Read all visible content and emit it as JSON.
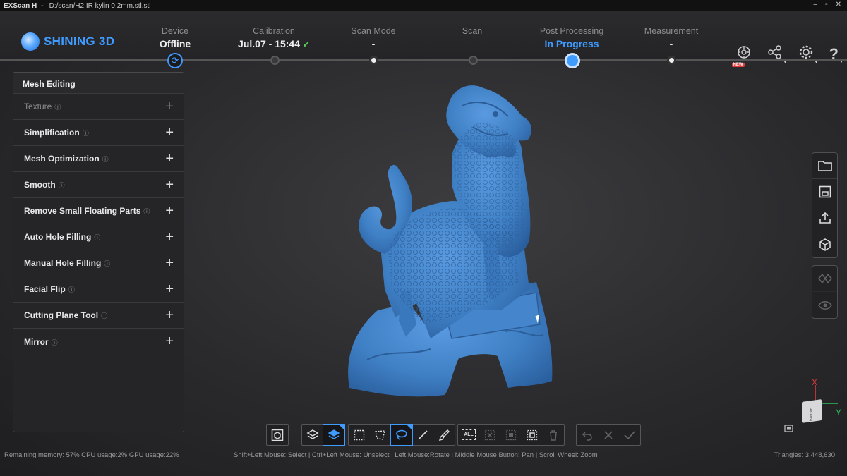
{
  "titlebar": {
    "app": "EXScan H",
    "separator": "-",
    "path": "D:/scan/H2 IR kylin 0.2mm.stl.stl",
    "controls": [
      "–",
      "▫",
      "✕"
    ]
  },
  "logo": {
    "text": "SHINING 3D"
  },
  "steps": [
    {
      "label": "Device",
      "value": "Offline"
    },
    {
      "label": "Calibration",
      "value": "Jul.07 - 15:44"
    },
    {
      "label": "Scan Mode",
      "value": "-"
    },
    {
      "label": "Scan",
      "value": ""
    },
    {
      "label": "Post Processing",
      "value": "In Progress"
    },
    {
      "label": "Measurement",
      "value": "-"
    }
  ],
  "header_icons": {
    "new_badge": "NEW"
  },
  "panel": {
    "title": "Mesh Editing",
    "items": [
      {
        "label": "Texture",
        "info": "ⓘ",
        "enabled": false
      },
      {
        "label": "Simplification",
        "info": "ⓘ",
        "enabled": true
      },
      {
        "label": "Mesh Optimization",
        "info": "ⓘ",
        "enabled": true
      },
      {
        "label": "Smooth",
        "info": "ⓘ",
        "enabled": true
      },
      {
        "label": "Remove Small Floating Parts",
        "info": "ⓘ",
        "enabled": true
      },
      {
        "label": "Auto Hole Filling",
        "info": "ⓘ",
        "enabled": true
      },
      {
        "label": "Manual Hole Filling",
        "info": "ⓘ",
        "enabled": true
      },
      {
        "label": "Facial Flip",
        "info": "ⓘ",
        "enabled": true
      },
      {
        "label": "Cutting Plane Tool",
        "info": "ⓘ",
        "enabled": true
      },
      {
        "label": "Mirror",
        "info": "ⓘ",
        "enabled": true
      }
    ]
  },
  "toolbar": {
    "select_all_label": "ALL"
  },
  "status": {
    "left": "Remaining memory: 57% CPU usage:2%  GPU usage:22%",
    "hint": "Shift+Left Mouse: Select | Ctrl+Left Mouse: Unselect | Left Mouse:Rotate | Middle Mouse Button: Pan | Scroll Wheel: Zoom",
    "triangles": "Triangles: 3,448,630"
  },
  "axis": {
    "x": "X",
    "y": "Y",
    "cube_face": "Bottom"
  },
  "colors": {
    "accent": "#3f9bff",
    "model": "#3f7fc4",
    "check": "#5ac85a"
  }
}
